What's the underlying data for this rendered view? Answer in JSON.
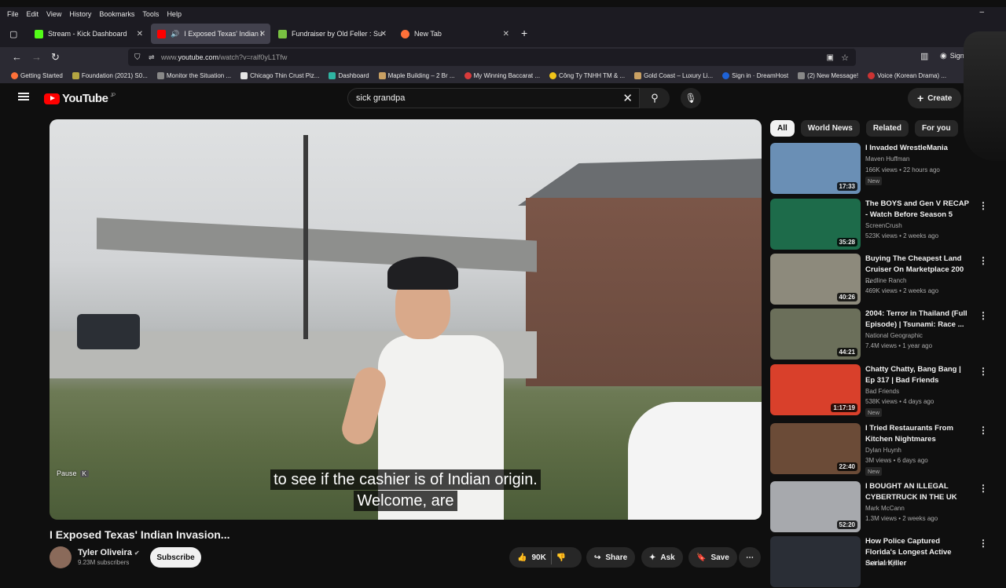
{
  "menubar": [
    "File",
    "Edit",
    "View",
    "History",
    "Bookmarks",
    "Tools",
    "Help"
  ],
  "tabs": [
    {
      "label": "Stream - Kick Dashboard",
      "color": "#53fc18"
    },
    {
      "label": "I Exposed Texas' Indian Inv...",
      "color": "#ff0000"
    },
    {
      "label": "Fundraiser by Old Feller : Supp...",
      "color": "#79c142"
    },
    {
      "label": "New Tab",
      "color": "#ff7139"
    }
  ],
  "url": {
    "prefix": "www.",
    "host": "youtube.com",
    "path": "/watch?v=ralf0yL1Tfw"
  },
  "signin": "Sign in",
  "bookmarks": [
    {
      "label": "Getting Started",
      "color": "#ff7139"
    },
    {
      "label": "Foundation (2021) S0...",
      "color": "#b5a642"
    },
    {
      "label": "Monitor the Situation ...",
      "color": "#888"
    },
    {
      "label": "Chicago Thin Crust Piz...",
      "color": "#e5e5e5"
    },
    {
      "label": "Dashboard",
      "color": "#2fb5a3"
    },
    {
      "label": "Maple Building – 2 Br ...",
      "color": "#c9a063"
    },
    {
      "label": "My Winning Baccarat ...",
      "color": "#d93b3b"
    },
    {
      "label": "Công Ty TNHH TM & ...",
      "color": "#f0c419"
    },
    {
      "label": "Gold Coast – Luxury Li...",
      "color": "#c9a063"
    },
    {
      "label": "Sign in · DreamHost",
      "color": "#1e62d6"
    },
    {
      "label": "(2) New Message!",
      "color": "#888"
    },
    {
      "label": "Voice (Korean Drama) ...",
      "color": "#c33"
    }
  ],
  "yt": {
    "logo": "YouTube",
    "region": "JP",
    "search": "sick grandpa",
    "create": "Create"
  },
  "video": {
    "pause_label": "Pause",
    "pause_key": "K",
    "subtitle_line1": "to see if the cashier is of Indian origin.",
    "subtitle_line2": "Welcome, are"
  },
  "title": "I Exposed Texas' Indian Invasion...",
  "channel": {
    "name": "Tyler Oliveira",
    "subs": "9.23M subscribers",
    "subscribe": "Subscribe"
  },
  "actions": {
    "likes": "90K",
    "share": "Share",
    "ask": "Ask",
    "save": "Save"
  },
  "chips": [
    "All",
    "World News",
    "Related",
    "For you",
    "Re"
  ],
  "recs": [
    {
      "title": "I Invaded WrestleMania",
      "channel": "Maven Huffman",
      "meta": "166K views • 22 hours ago",
      "new": "New",
      "dur": "17:33",
      "bg": "#6a8fb5"
    },
    {
      "title": "The BOYS and Gen V RECAP - Watch Before Season 5",
      "channel": "ScreenCrush",
      "meta": "523K views • 2 weeks ago",
      "new": "",
      "dur": "35:28",
      "bg": "#1d6b4a"
    },
    {
      "title": "Buying The Cheapest Land Cruiser On Marketplace 200 ...",
      "channel": "Redline Ranch",
      "meta": "469K views • 2 weeks ago",
      "new": "",
      "dur": "40:26",
      "bg": "#8d8a7c"
    },
    {
      "title": "2004: Terror in Thailand (Full Episode) | Tsunami: Race ...",
      "channel": "National Geographic",
      "meta": "7.4M views • 1 year ago",
      "new": "",
      "dur": "44:21",
      "bg": "#6b6f5a"
    },
    {
      "title": "Chatty Chatty, Bang Bang | Ep 317 | Bad Friends",
      "channel": "Bad Friends",
      "meta": "538K views • 4 days ago",
      "new": "New",
      "dur": "1:17:19",
      "bg": "#d9402b"
    },
    {
      "title": "I Tried Restaurants From Kitchen Nightmares",
      "channel": "Dylan Huynh",
      "meta": "3M views • 6 days ago",
      "new": "New",
      "dur": "22:40",
      "bg": "#6b4b37"
    },
    {
      "title": "I BOUGHT AN ILLEGAL CYBERTRUCK IN THE UK",
      "channel": "Mark McCann",
      "meta": "1.3M views • 2 weeks ago",
      "new": "",
      "dur": "52:20",
      "bg": "#a7a9ad"
    },
    {
      "title": "How Police Captured Florida's Longest Active Serial Killer",
      "channel": "Dr Insanity",
      "meta": "",
      "new": "",
      "dur": "",
      "bg": "#2a2e36"
    }
  ]
}
